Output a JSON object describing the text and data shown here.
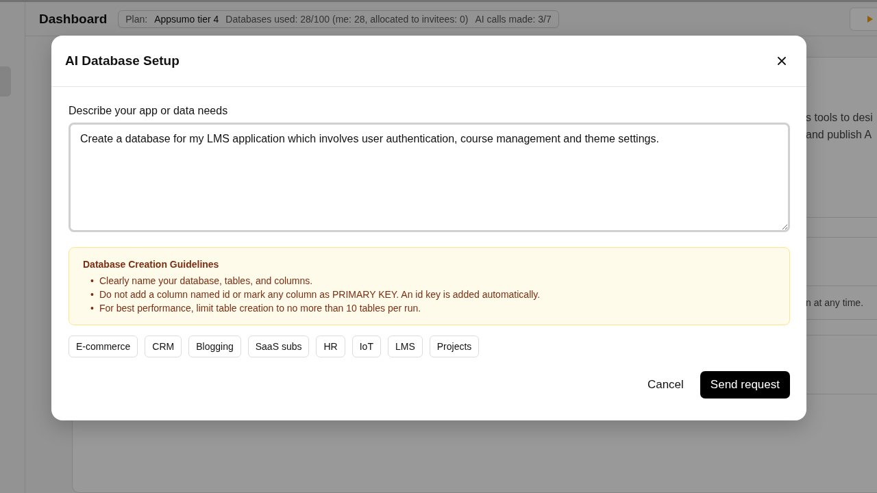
{
  "header": {
    "title": "Dashboard",
    "plan_label": "Plan:",
    "plan_value": "Appsumo tier 4",
    "databases_used": "Databases used: 28/100 (me: 28, allocated to invitees: 0)",
    "ai_calls": "AI calls made: 3/7"
  },
  "background_fragments": [
    "s tools to desi",
    "and publish A",
    "n at any time."
  ],
  "modal": {
    "title": "AI Database Setup",
    "field_label": "Describe your app or data needs",
    "value": "Create a database for my LMS application which involves user authentication, course management and theme settings.",
    "guidelines": {
      "title": "Database Creation Guidelines",
      "bullet": "•",
      "items": [
        "Clearly name your database, tables, and columns.",
        "Do not add a column named id or mark any column as PRIMARY KEY. An id key is added automatically.",
        "For best performance, limit table creation to no more than 10 tables per run."
      ]
    },
    "templates": [
      "E-commerce",
      "CRM",
      "Blogging",
      "SaaS subs",
      "HR",
      "IoT",
      "LMS",
      "Projects"
    ],
    "cancel": "Cancel",
    "submit": "Send request"
  }
}
